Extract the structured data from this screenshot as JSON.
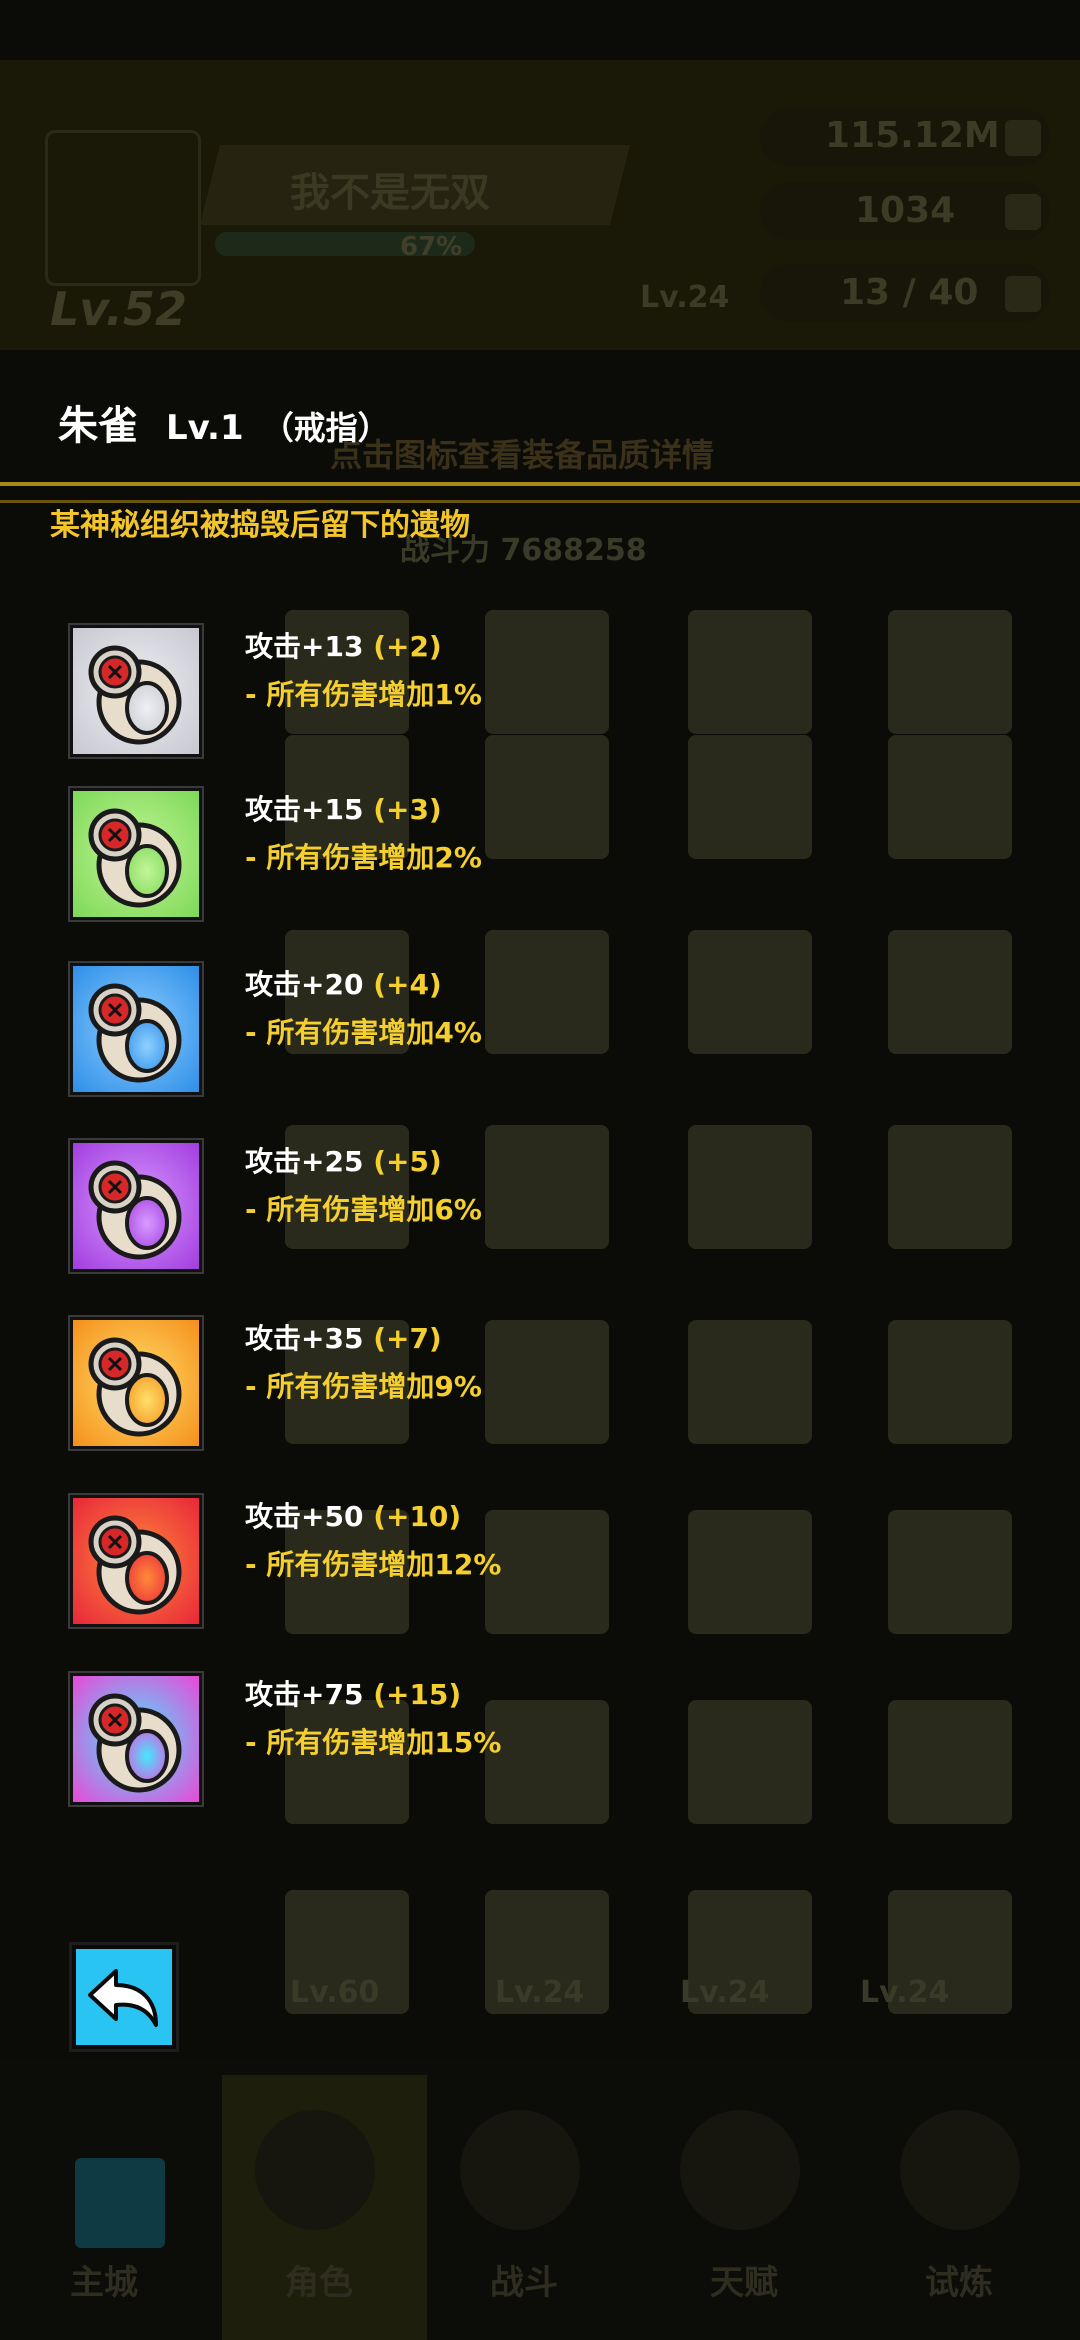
{
  "background": {
    "player_name": "我不是无双",
    "exp_text": "67%",
    "player_level": "Lv.52",
    "gold": "115.12M",
    "gems": "1034",
    "stamina": "13 / 40",
    "energy_level": "Lv.24",
    "hint": "点击图标查看装备品质详情",
    "power": "战斗力 7688258",
    "slot_levels": [
      "Lv.60",
      "Lv.24",
      "Lv.24",
      "Lv.24"
    ],
    "nav": [
      "主城",
      "角色",
      "战斗",
      "天赋",
      "试炼"
    ]
  },
  "item": {
    "name": "朱雀",
    "level": "Lv.1",
    "slot": "（戒指）",
    "description": "某神秘组织被捣毁后留下的遗物"
  },
  "tiers": [
    {
      "stat": "攻击+13",
      "bonus": "(+2)",
      "effect": "- 所有伤害增加1%",
      "color": "#c8c8d0",
      "accent": "#eef0f4"
    },
    {
      "stat": "攻击+15",
      "bonus": "(+3)",
      "effect": "- 所有伤害增加2%",
      "color": "#7ed957",
      "accent": "#c3f59a"
    },
    {
      "stat": "攻击+20",
      "bonus": "(+4)",
      "effect": "- 所有伤害增加4%",
      "color": "#2f8fe8",
      "accent": "#8fd0ff"
    },
    {
      "stat": "攻击+25",
      "bonus": "(+5)",
      "effect": "- 所有伤害增加6%",
      "color": "#a23ee0",
      "accent": "#d99bff"
    },
    {
      "stat": "攻击+35",
      "bonus": "(+7)",
      "effect": "- 所有伤害增加9%",
      "color": "#f5901c",
      "accent": "#ffe06a"
    },
    {
      "stat": "攻击+50",
      "bonus": "(+10)",
      "effect": "- 所有伤害增加12%",
      "color": "#e8283a",
      "accent": "#ff8a3a"
    },
    {
      "stat": "攻击+75",
      "bonus": "(+15)",
      "effect": "- 所有伤害增加15%",
      "color": "#e84ad8",
      "accent": "#46e8ff"
    }
  ],
  "colors": {
    "title": "#ffffff",
    "gold_text": "#f4cf2e",
    "divider": "#a8891a",
    "back_button": "#29c4f2"
  },
  "icons": {
    "back": "back-arrow-icon",
    "ring": "ring-icon"
  }
}
